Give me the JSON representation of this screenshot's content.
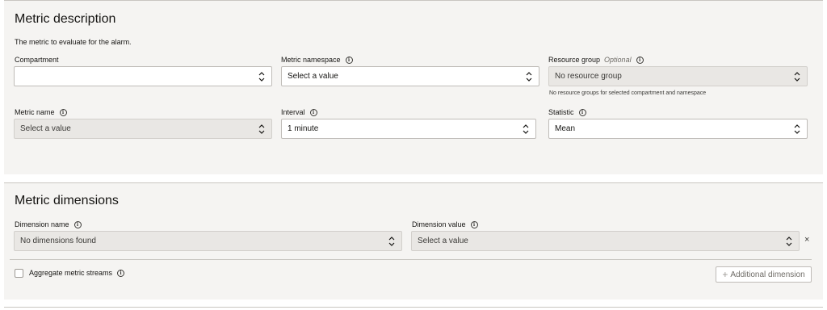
{
  "metric_description": {
    "title": "Metric description",
    "description": "The metric to evaluate for the alarm.",
    "compartment": {
      "label": "Compartment",
      "value": ""
    },
    "metric_namespace": {
      "label": "Metric namespace",
      "value": "Select a value"
    },
    "resource_group": {
      "label": "Resource group",
      "optional": "Optional",
      "value": "No resource group",
      "helper": "No resource groups for selected compartment and namespace"
    },
    "metric_name": {
      "label": "Metric name",
      "value": "Select a value"
    },
    "interval": {
      "label": "Interval",
      "value": "1 minute"
    },
    "statistic": {
      "label": "Statistic",
      "value": "Mean"
    }
  },
  "metric_dimensions": {
    "title": "Metric dimensions",
    "dimension_name": {
      "label": "Dimension name",
      "value": "No dimensions found"
    },
    "dimension_value": {
      "label": "Dimension value",
      "value": "Select a value"
    },
    "remove": "×",
    "aggregate": {
      "label": "Aggregate metric streams",
      "checked": false
    },
    "add_button": {
      "plus": "+",
      "label": "Additional dimension"
    }
  },
  "icons": {
    "info": "i",
    "info_icon": "info-circle-icon",
    "select_icon": "chevron-up-down-icon",
    "close_icon": "close-icon"
  },
  "colors": {
    "panel_bg": "#f5f4f2",
    "border": "#bfbcb8",
    "disabled_bg": "#e9e7e4",
    "text": "#161513"
  }
}
